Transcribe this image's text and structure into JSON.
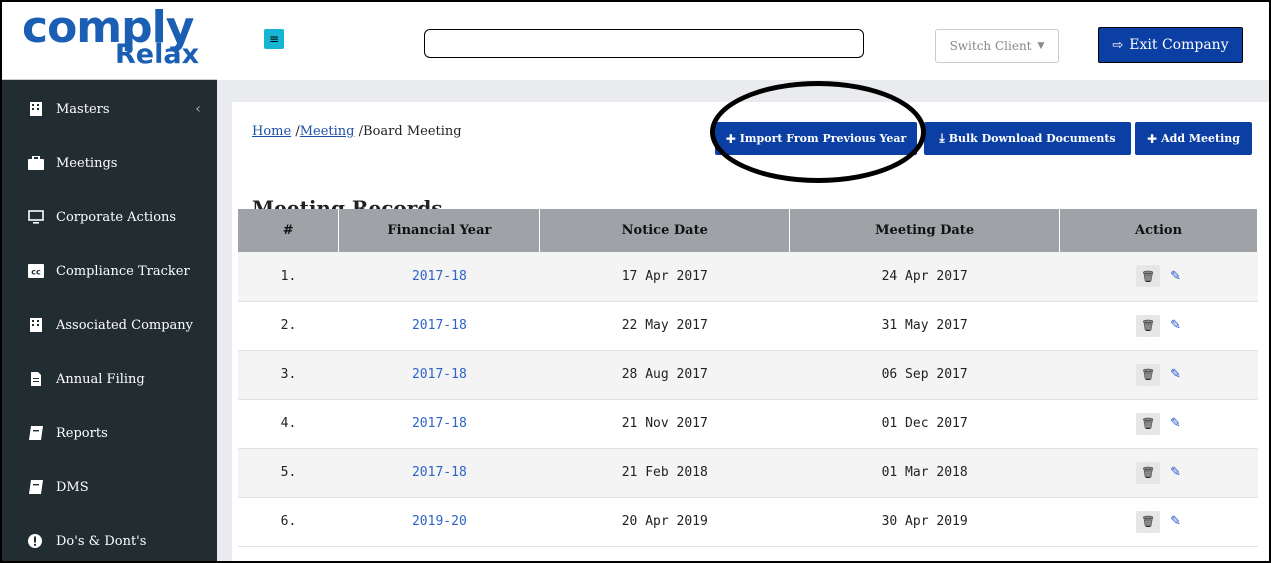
{
  "logo": {
    "line1": "comply",
    "line2": "Relax"
  },
  "sidebar": {
    "items": [
      {
        "label": "Masters",
        "icon": "building-icon",
        "has_chevron": true,
        "chevron": "‹"
      },
      {
        "label": "Meetings",
        "icon": "briefcase-icon"
      },
      {
        "label": "Corporate Actions",
        "icon": "monitor-icon"
      },
      {
        "label": "Compliance Tracker",
        "icon": "cc-icon"
      },
      {
        "label": "Associated Company",
        "icon": "building-icon"
      },
      {
        "label": "Annual Filing",
        "icon": "file-icon"
      },
      {
        "label": "Reports",
        "icon": "book-icon"
      },
      {
        "label": "DMS",
        "icon": "book-icon"
      },
      {
        "label": "Do's & Dont's",
        "icon": "exclamation-icon"
      }
    ]
  },
  "header": {
    "menu_icon": "≡",
    "search_value": "",
    "switch_client": "Switch Client",
    "exit_label": "Exit Company"
  },
  "breadcrumb": {
    "home": "Home",
    "sep1": "/",
    "meeting": "Meeting",
    "sep2": "/",
    "current": "Board Meeting"
  },
  "buttons": {
    "import": "Import From Previous Year",
    "bulk": "Bulk Download Documents",
    "add": "Add Meeting"
  },
  "section_title": "Meeting Records",
  "table": {
    "headers": [
      "#",
      "Financial Year",
      "Notice Date",
      "Meeting Date",
      "Action"
    ],
    "rows": [
      {
        "num": "1.",
        "fy": "2017-18",
        "notice": "17 Apr 2017",
        "meeting": "24 Apr 2017"
      },
      {
        "num": "2.",
        "fy": "2017-18",
        "notice": "22 May 2017",
        "meeting": "31 May 2017"
      },
      {
        "num": "3.",
        "fy": "2017-18",
        "notice": "28 Aug 2017",
        "meeting": "06 Sep 2017"
      },
      {
        "num": "4.",
        "fy": "2017-18",
        "notice": "21 Nov 2017",
        "meeting": "01 Dec 2017"
      },
      {
        "num": "5.",
        "fy": "2017-18",
        "notice": "21 Feb 2018",
        "meeting": "01 Mar 2018"
      },
      {
        "num": "6.",
        "fy": "2019-20",
        "notice": "20 Apr 2019",
        "meeting": "30 Apr 2019"
      }
    ]
  },
  "colors": {
    "primary": "#0c3fa3",
    "sidebar": "#222d32",
    "link": "#2d63c8",
    "menu_button": "#17b5d4"
  }
}
